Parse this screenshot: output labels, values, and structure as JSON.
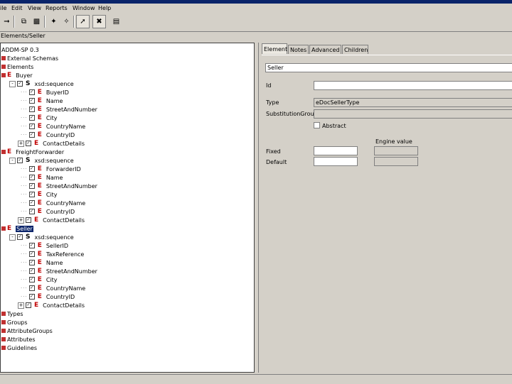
{
  "menu": {
    "file": "ile",
    "edit": "Edit",
    "view": "View",
    "reports": "Reports",
    "window": "Window",
    "help": "Help"
  },
  "toolbar": {
    "icons": [
      "arrow-right-icon",
      "copy-icon",
      "paste-icon",
      "wand-icon",
      "wand-alt-icon",
      "pointer-icon",
      "cross-icon",
      "properties-icon"
    ]
  },
  "path": "Elements/Seller",
  "tree": {
    "root": "ADDM-SP 0.3",
    "external_schemas": "External Schemas",
    "elements": "Elements",
    "buyer": {
      "name": "Buyer",
      "sequence": "xsd:sequence",
      "children": [
        "BuyerID",
        "Name",
        "StreetAndNumber",
        "City",
        "CountryName",
        "CountryID",
        "ContactDetails"
      ]
    },
    "freight_forwarder": {
      "name": "FreightForwarder",
      "sequence": "xsd:sequence",
      "children": [
        "ForwarderID",
        "Name",
        "StreetAndNumber",
        "City",
        "CountryName",
        "CountryID",
        "ContactDetails"
      ]
    },
    "seller": {
      "name": "Seller",
      "sequence": "xsd:sequence",
      "children": [
        "SellerID",
        "TaxReference",
        "Name",
        "StreetAndNumber",
        "City",
        "CountryName",
        "CountryID",
        "ContactDetails"
      ]
    },
    "types": "Types",
    "groups": "Groups",
    "attribute_groups": "AttributeGroups",
    "attributes": "Attributes",
    "guidelines": "Guidelines"
  },
  "tabs": [
    "Element",
    "Notes",
    "Advanced",
    "Children"
  ],
  "form": {
    "name_value": "Seller",
    "id_label": "Id",
    "id_value": "",
    "type_label": "Type",
    "type_value": "eDocSellerType",
    "substitution_label": "SubstitutionGroup",
    "substitution_value": "",
    "abstract_label": "Abstract",
    "engine_value_label": "Engine value",
    "fixed_label": "Fixed",
    "fixed_value": "",
    "default_label": "Default",
    "default_value": ""
  }
}
